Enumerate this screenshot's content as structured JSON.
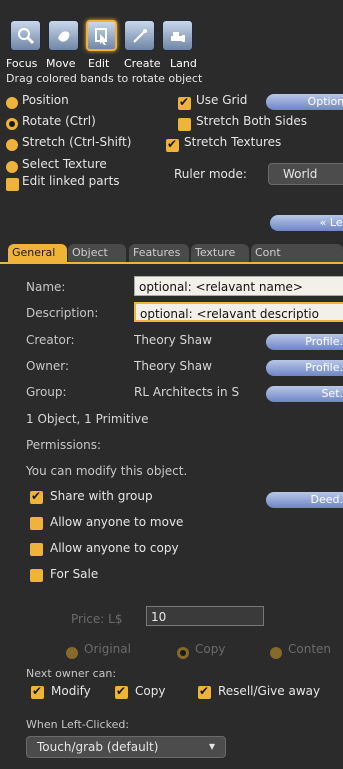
{
  "tools": {
    "focus": "Focus",
    "move": "Move",
    "edit": "Edit",
    "create": "Create",
    "land": "Land"
  },
  "hint": "Drag colored bands to rotate object",
  "modes": {
    "position": "Position",
    "rotate": "Rotate (Ctrl)",
    "stretch": "Stretch (Ctrl-Shift)",
    "select_texture": "Select Texture",
    "edit_linked": "Edit linked parts"
  },
  "options": {
    "use_grid": "Use Grid",
    "options_button": "Options",
    "stretch_both_sides": "Stretch Both Sides",
    "stretch_textures": "Stretch Textures",
    "ruler_mode_label": "Ruler mode:",
    "ruler_mode_value": "World",
    "less_button": "« Less"
  },
  "tabs": [
    "General",
    "Object",
    "Features",
    "Texture",
    "Cont"
  ],
  "general": {
    "name_label": "Name:",
    "name_value": "optional: <relavant name>",
    "description_label": "Description:",
    "description_value": "optional: <relavant descriptio",
    "creator_label": "Creator:",
    "creator_value": "Theory Shaw",
    "owner_label": "Owner:",
    "owner_value": "Theory Shaw",
    "group_label": "Group:",
    "group_value": "RL Architects in S",
    "profile_button": "Profile...",
    "set_button": "Set...",
    "counts": "1 Object, 1 Primitive",
    "permissions_label": "Permissions:",
    "modify_text": "You can modify this object.",
    "share_with_group": "Share with group",
    "deed_button": "Deed...",
    "allow_move": "Allow anyone to move",
    "allow_copy": "Allow anyone to copy",
    "for_sale": "For Sale",
    "price_label": "Price: L$",
    "price_value": "10",
    "sale_types": [
      "Original",
      "Copy",
      "Conten"
    ],
    "next_owner_label": "Next owner can:",
    "next_modify": "Modify",
    "next_copy": "Copy",
    "next_resell": "Resell/Give away",
    "when_left_clicked_label": "When Left-Clicked:",
    "when_left_clicked_value": "Touch/grab (default)"
  }
}
